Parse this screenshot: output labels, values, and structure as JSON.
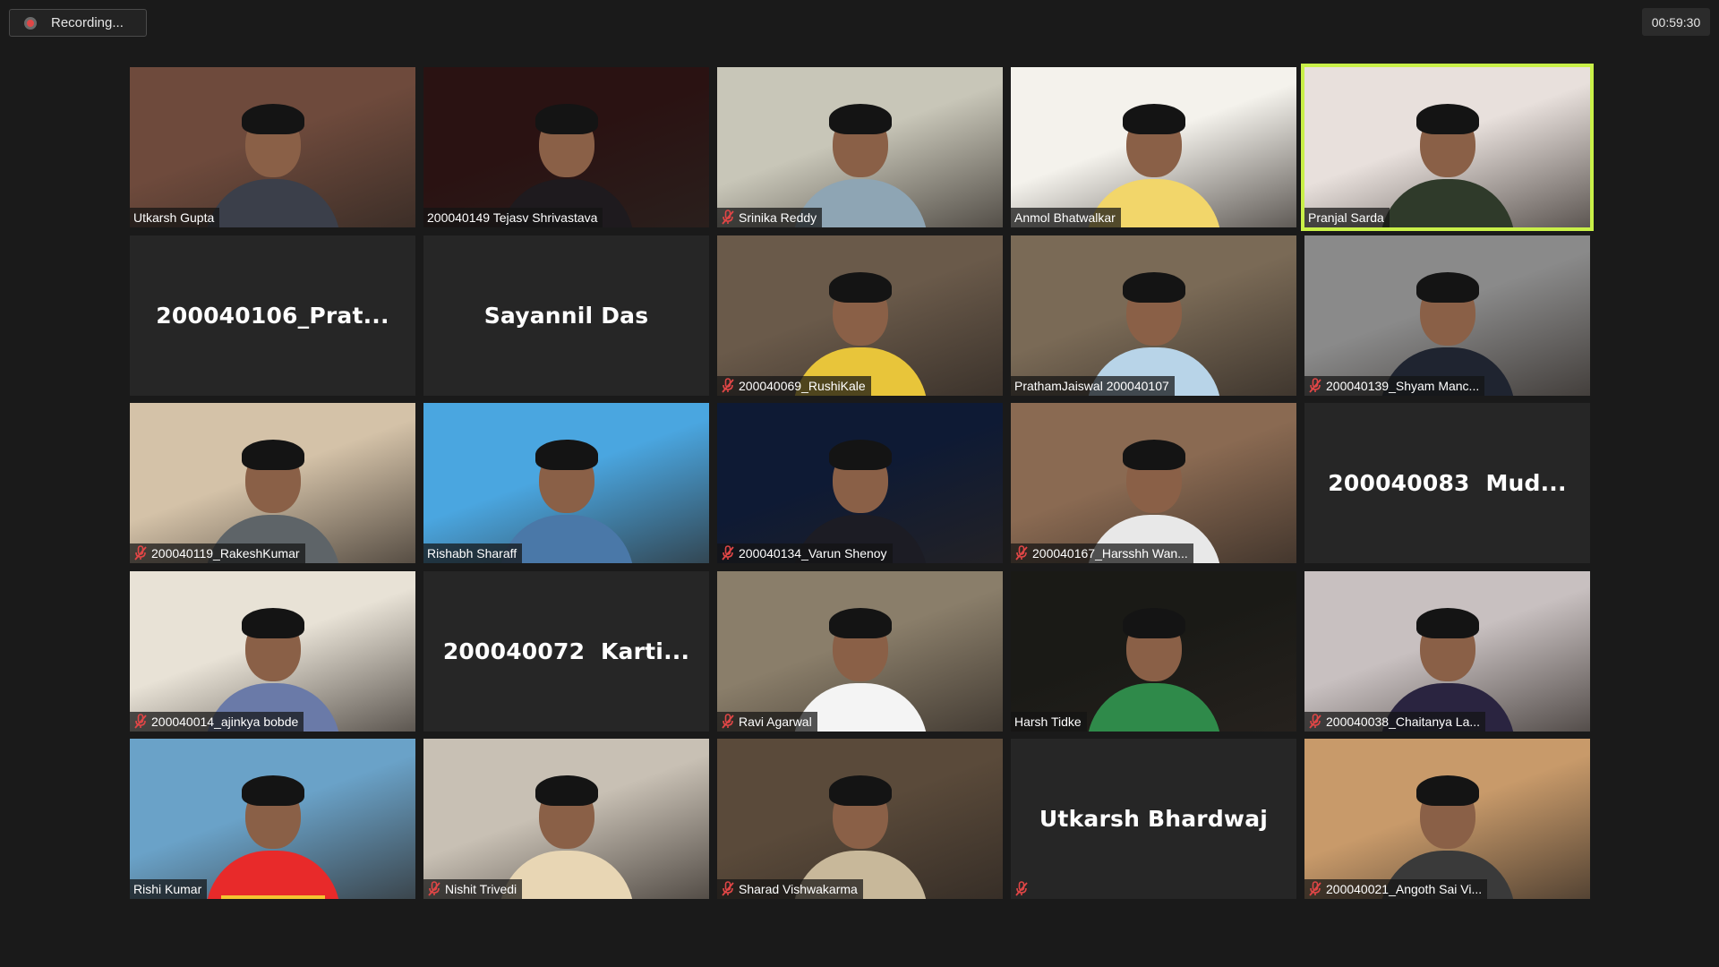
{
  "recording": {
    "label": "Recording..."
  },
  "timer": {
    "value": "00:59:30"
  },
  "colors": {
    "active_speaker_border": "#c9f048",
    "muted_icon": "#e04646",
    "speaking_indicator": "#f4c430"
  },
  "participants": [
    {
      "name": "Utkarsh Gupta",
      "video": true,
      "muted": false,
      "shirt": "#3b3f4a",
      "bg": "#6e4a3c"
    },
    {
      "name": "200040149 Tejasv Shrivastava",
      "video": true,
      "muted": false,
      "shirt": "#1e1a1e",
      "bg": "#2a1212"
    },
    {
      "name": "Srinika Reddy",
      "video": true,
      "muted": true,
      "shirt": "#8ea5b4",
      "bg": "#c8c6b8"
    },
    {
      "name": "Anmol Bhatwalkar",
      "video": true,
      "muted": false,
      "shirt": "#f2d66a",
      "bg": "#f4f2ec"
    },
    {
      "name": "Pranjal Sarda",
      "video": true,
      "muted": false,
      "active": true,
      "shirt": "#2f3a2a",
      "bg": "#e8e0dc"
    },
    {
      "name": "200040106_Prat...",
      "video": false,
      "muted": false
    },
    {
      "name": "Sayannil Das",
      "video": false,
      "muted": false
    },
    {
      "name": "200040069_RushiKale",
      "video": true,
      "muted": true,
      "shirt": "#e8c53a",
      "bg": "#6a5a4a"
    },
    {
      "name": "PrathamJaiswal 200040107",
      "video": true,
      "muted": false,
      "shirt": "#b8d4e8",
      "bg": "#7a6a56"
    },
    {
      "name": "200040139_Shyam Manc...",
      "video": true,
      "muted": true,
      "shirt": "#1f2430",
      "bg": "#8a8a8a"
    },
    {
      "name": "200040119_RakeshKumar",
      "video": true,
      "muted": true,
      "shirt": "#5e6468",
      "bg": "#d4c2a8"
    },
    {
      "name": "Rishabh Sharaff",
      "video": true,
      "muted": false,
      "shirt": "#4a78a8",
      "bg": "#4aa6e0"
    },
    {
      "name": "200040134_Varun Shenoy",
      "video": true,
      "muted": true,
      "shirt": "#1c1c24",
      "bg": "#0e1a34"
    },
    {
      "name": "200040167_Harsshh Wan...",
      "video": true,
      "muted": true,
      "shirt": "#e8e8e8",
      "bg": "#8a6a52"
    },
    {
      "name": "200040083  Mud...",
      "video": false,
      "muted": false
    },
    {
      "name": "200040014_ajinkya bobde",
      "video": true,
      "muted": true,
      "shirt": "#6a7aa8",
      "bg": "#e8e2d6"
    },
    {
      "name": "200040072  Karti...",
      "video": false,
      "muted": false
    },
    {
      "name": "Ravi Agarwal",
      "video": true,
      "muted": true,
      "shirt": "#f4f4f4",
      "bg": "#8a7e6a"
    },
    {
      "name": "Harsh Tidke",
      "video": true,
      "muted": false,
      "shirt": "#2f8a4a",
      "bg": "#1a1a16"
    },
    {
      "name": "200040038_Chaitanya La...",
      "video": true,
      "muted": true,
      "shirt": "#2a2440",
      "bg": "#c8c0c0"
    },
    {
      "name": "Rishi Kumar",
      "video": true,
      "muted": false,
      "speaking": true,
      "shirt": "#e82a2a",
      "bg": "#6aa2c8"
    },
    {
      "name": "Nishit Trivedi",
      "video": true,
      "muted": true,
      "shirt": "#e8d6b4",
      "bg": "#c8c0b4"
    },
    {
      "name": "Sharad Vishwakarma",
      "video": true,
      "muted": true,
      "shirt": "#c8b89a",
      "bg": "#5a4a3a"
    },
    {
      "name": "Utkarsh Bhardwaj",
      "video": false,
      "muted": true,
      "center_only": true
    },
    {
      "name": "200040021_Angoth Sai Vi...",
      "video": true,
      "muted": true,
      "shirt": "#3a3a3a",
      "bg": "#c89a6a"
    }
  ]
}
